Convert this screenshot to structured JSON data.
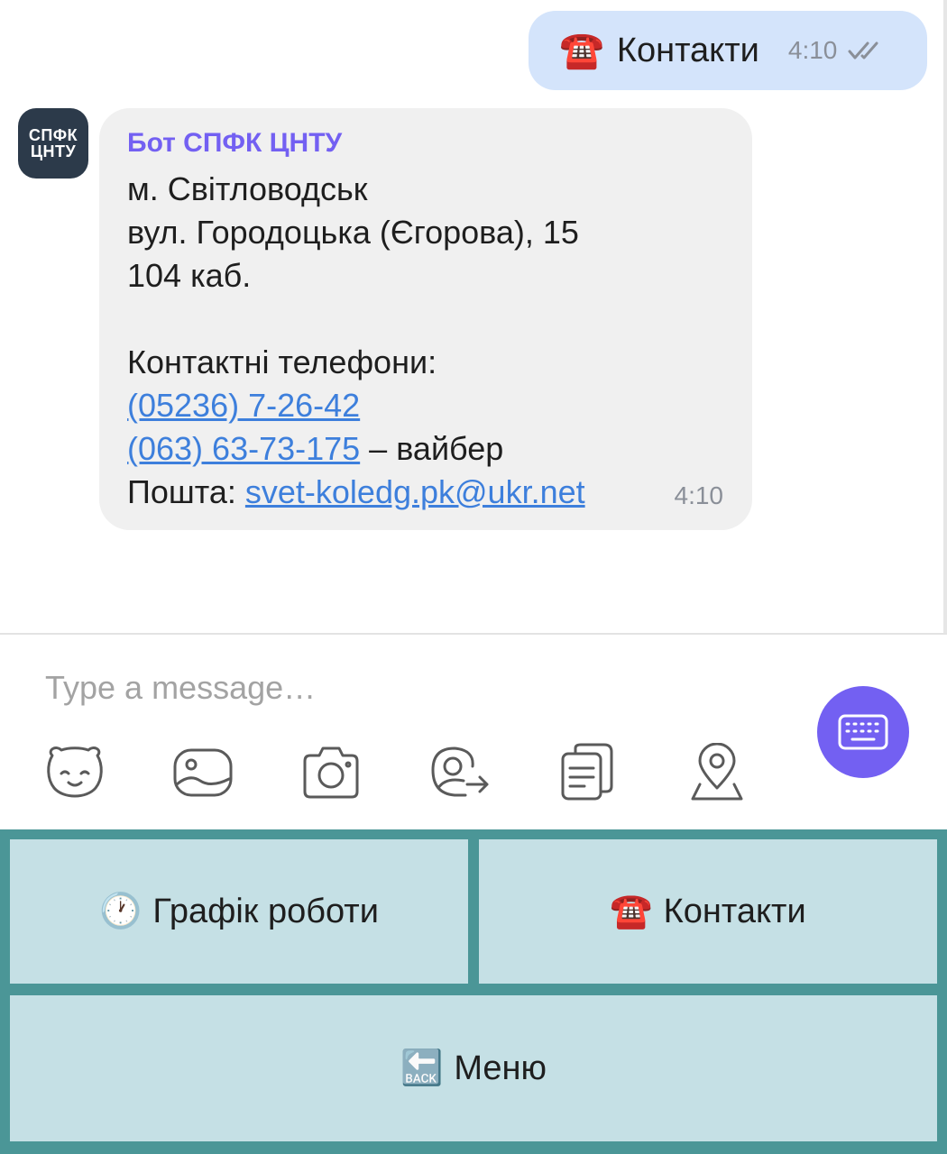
{
  "chat": {
    "outgoing": {
      "emoji": "☎️",
      "text": "Контакти",
      "time": "4:10",
      "status_icon": "double-check-icon"
    },
    "incoming": {
      "avatar_line1": "СПФК",
      "avatar_line2": "ЦНТУ",
      "sender": "Бот СПФК ЦНТУ",
      "city": "м. Світловодськ",
      "street": "вул. Городоцька (Єгорова), 15",
      "room": "104 каб.",
      "phones_label": "Контактні телефони:",
      "phone1": "(05236) 7-26-42",
      "phone2": "(063) 63-73-175",
      "phone2_suffix": " – вайбер",
      "email_label": "Пошта: ",
      "email": "svet-koledg.pk@ukr.net",
      "time": "4:10"
    }
  },
  "composer": {
    "placeholder": "Type a message…",
    "tools": [
      "sticker-icon",
      "gallery-icon",
      "camera-icon",
      "share-contact-icon",
      "notes-icon",
      "location-icon"
    ],
    "keyboard_toggle_icon": "keyboard-icon",
    "accent": "#7360f2"
  },
  "bot_keyboard": {
    "schedule": {
      "emoji": "🕐",
      "label": "Графік роботи"
    },
    "contacts": {
      "emoji": "☎️",
      "label": "Контакти"
    },
    "menu": {
      "emoji": "🔙",
      "label": "Меню"
    },
    "background": "#4b9697",
    "button_color": "#c5e0e5"
  }
}
